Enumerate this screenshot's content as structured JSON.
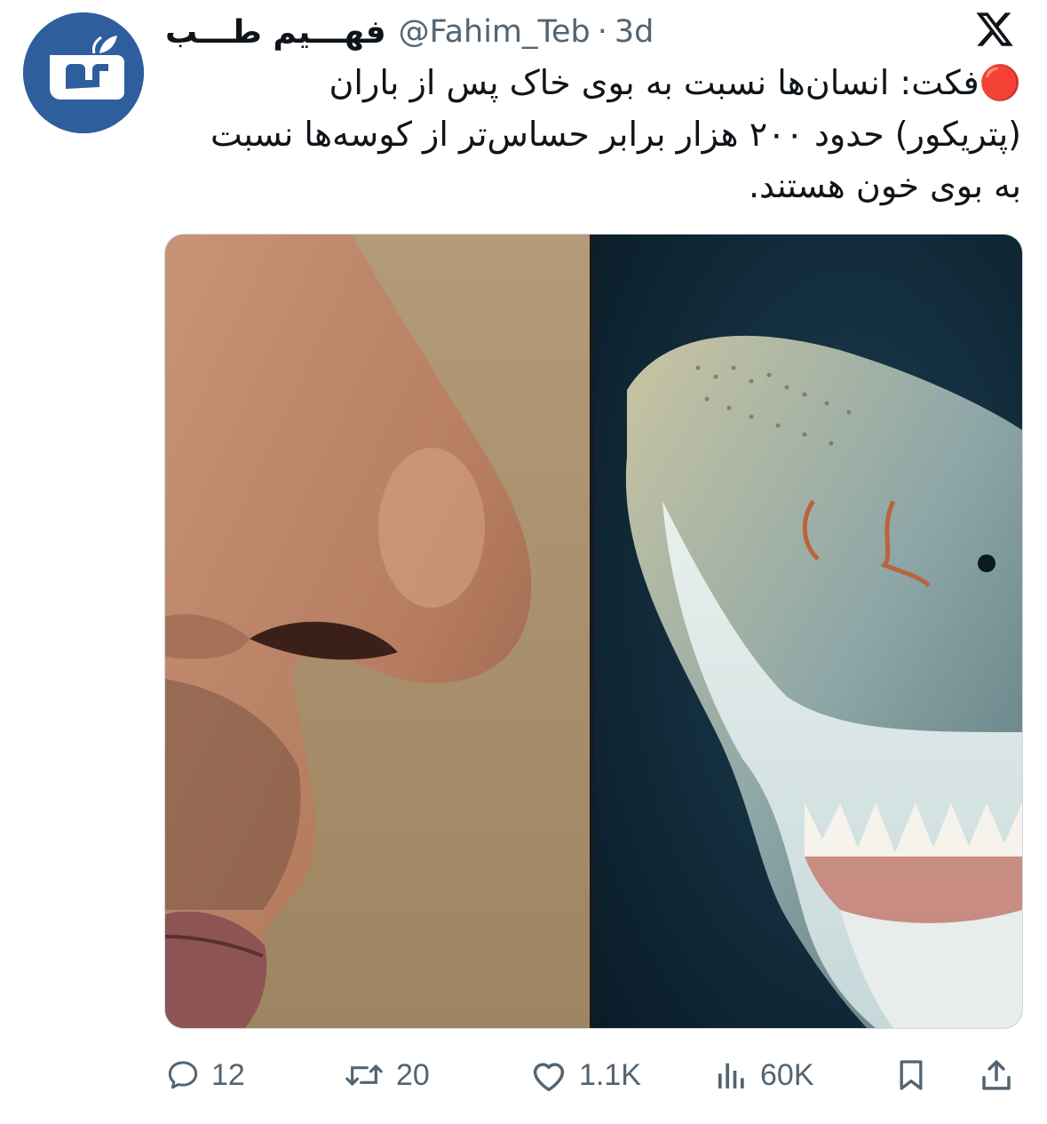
{
  "tweet": {
    "author": {
      "display_name": "فهـــیم طـــب",
      "handle": "@Fahim_Teb",
      "separator": "·",
      "time": "3d",
      "avatar_icon": "fahim-teb-logo-icon"
    },
    "platform_icon": "x-logo-icon",
    "text": "🔴فکت: انسان‌ها نسبت به بوی خاک پس از باران\n(پتریکور) حدود ۲۰۰ هزار برابر حساس‌تر از کوسه‌ها نسبت\nبه بوی خون هستند.",
    "media": {
      "left_panel": "human-nose-photo",
      "right_panel": "shark-snout-photo"
    },
    "actions": {
      "replies": "12",
      "reposts": "20",
      "likes": "1.1K",
      "views": "60K"
    },
    "colors": {
      "text": "#0f1419",
      "secondary": "#536471",
      "avatar_bg": "#2f5e9e"
    }
  }
}
